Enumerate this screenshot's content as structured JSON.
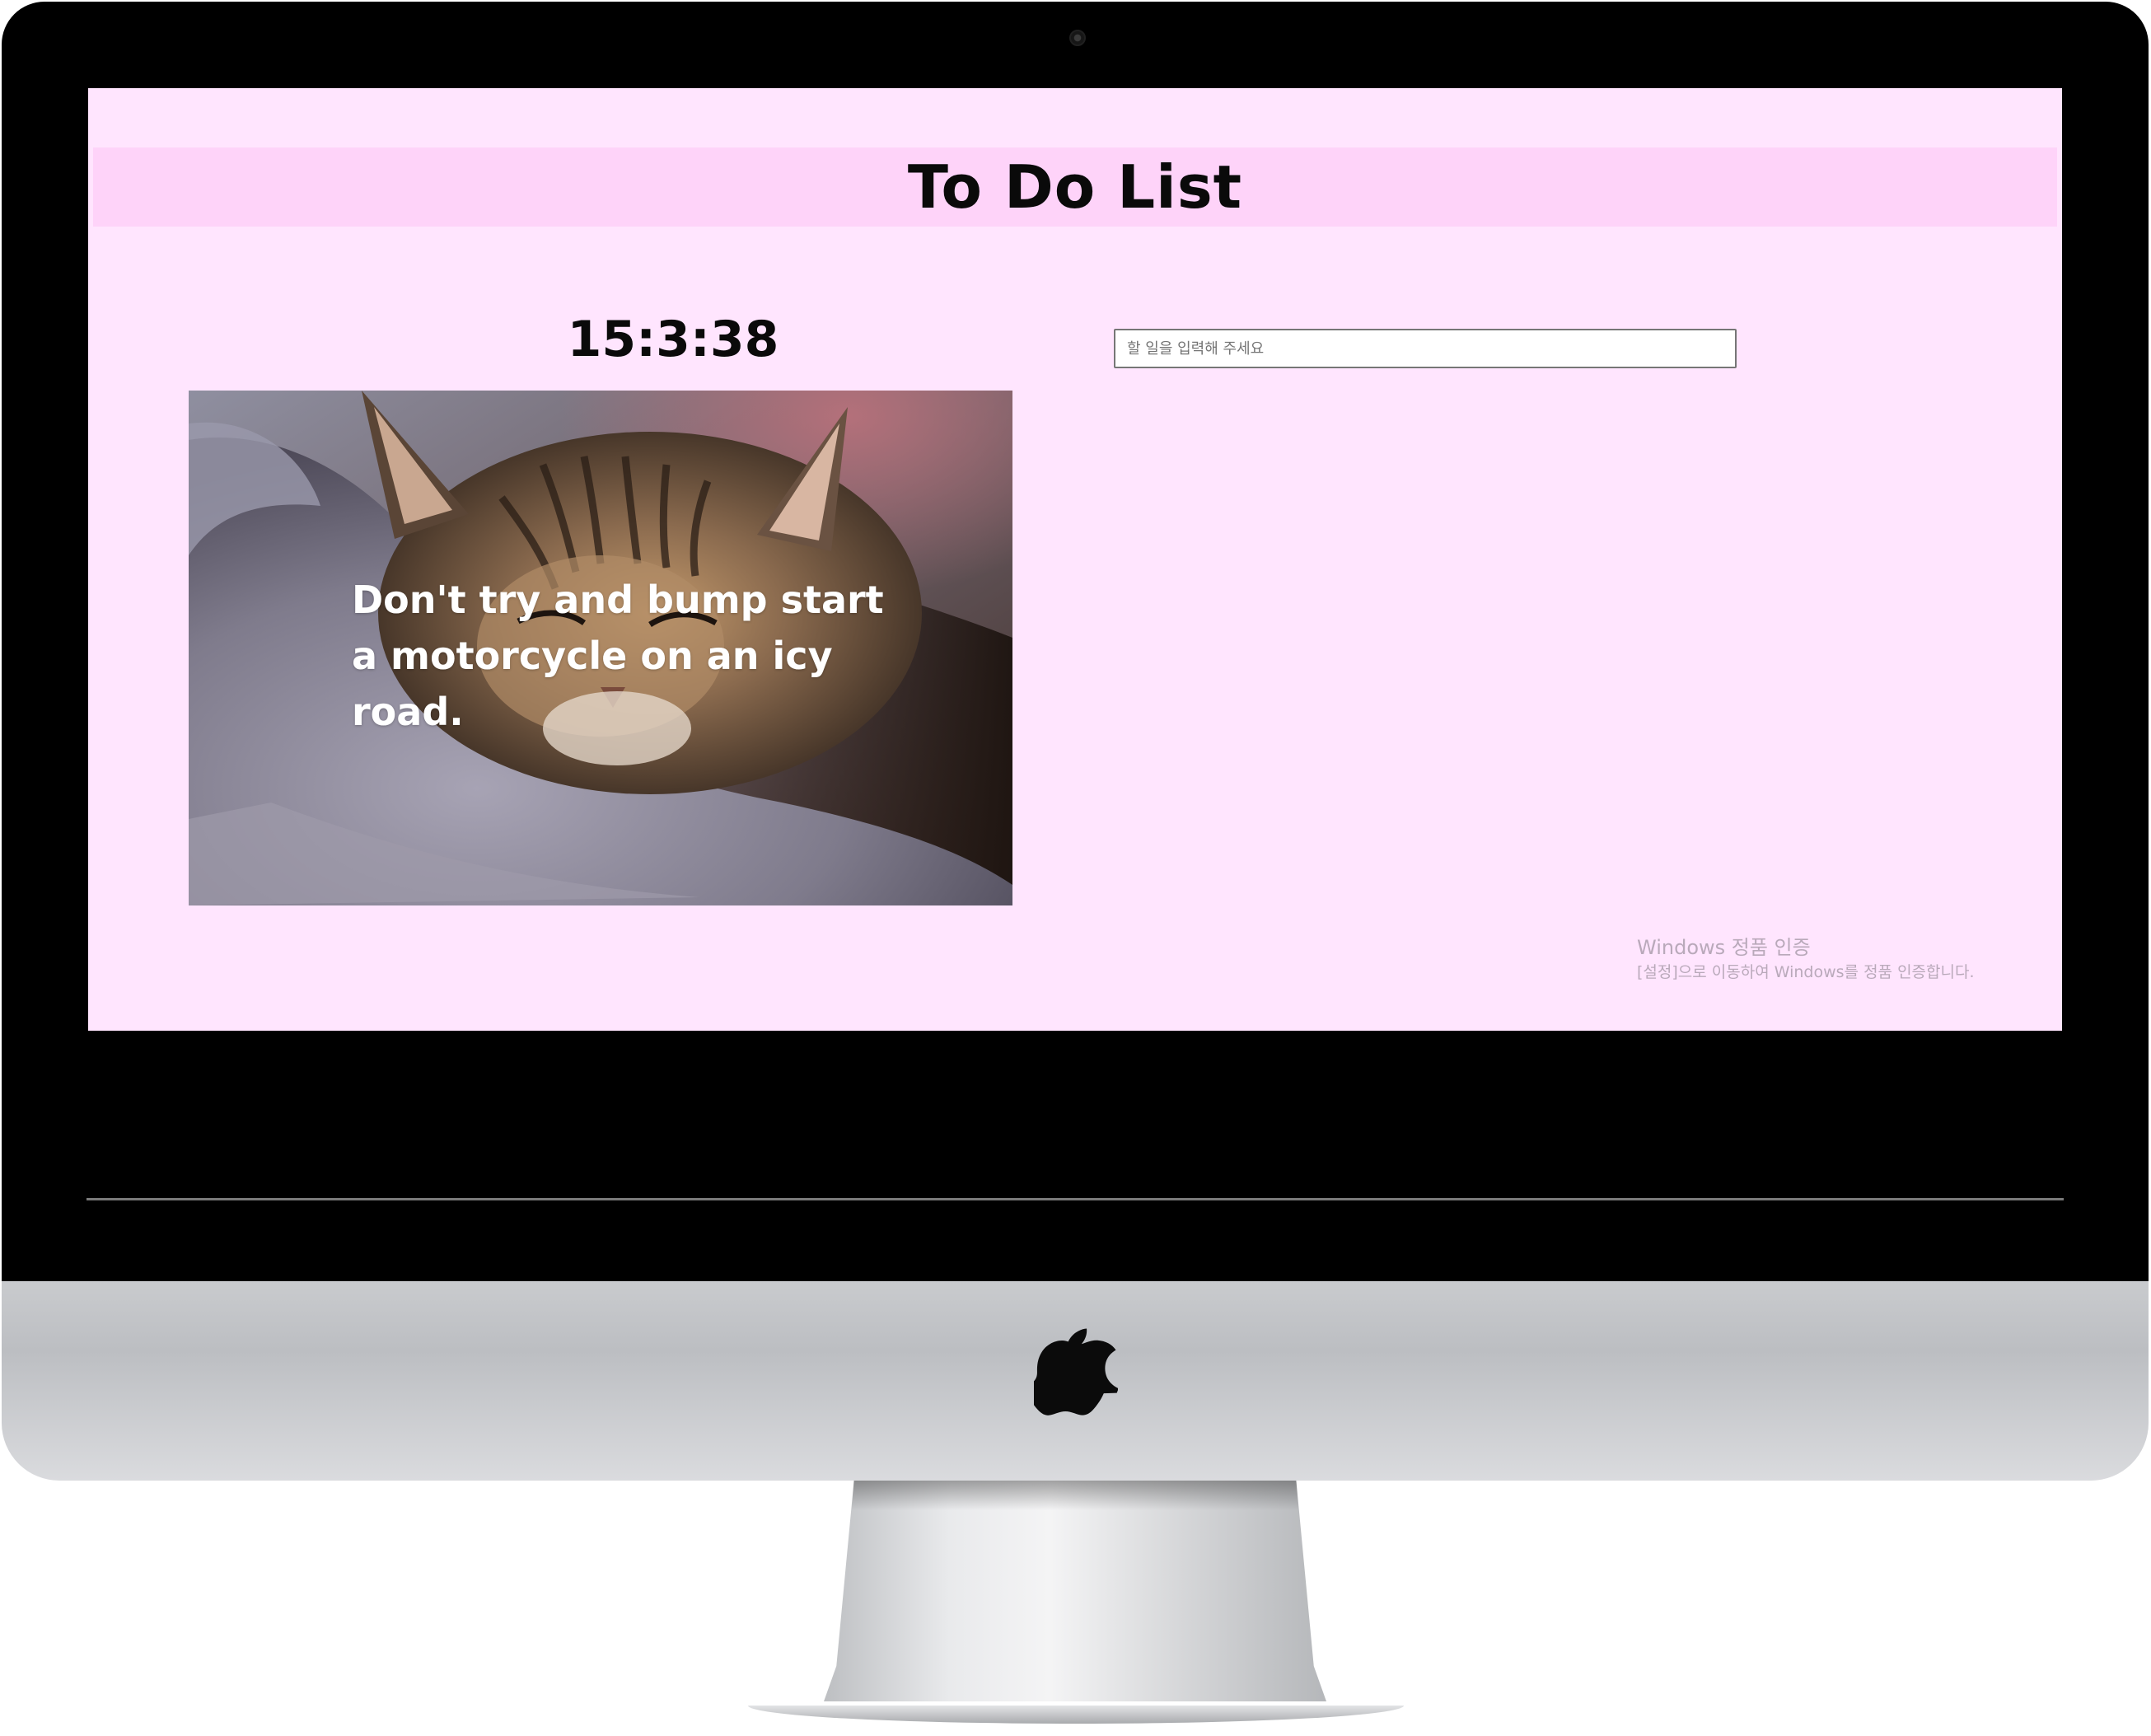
{
  "app": {
    "title": "To Do List"
  },
  "clock": {
    "time": "15:3:38"
  },
  "greeting_image": {
    "quote": "Don't try and bump start a motorcycle on an icy road."
  },
  "todo": {
    "input_placeholder": "할 일을 입력해 주세요",
    "input_value": "",
    "items": []
  },
  "system_overlay": {
    "activation_title": "Windows 정품 인증",
    "activation_message": "[설정]으로 이동하여 Windows를 정품 인증합니다."
  },
  "colors": {
    "page_background": "#ffe5fe",
    "header_band": "#fed3f9",
    "text": "#0a0a0a",
    "quote_text": "#ffffff"
  },
  "icons": {
    "hardware_logo": "apple-logo-icon",
    "webcam": "camera-icon"
  }
}
